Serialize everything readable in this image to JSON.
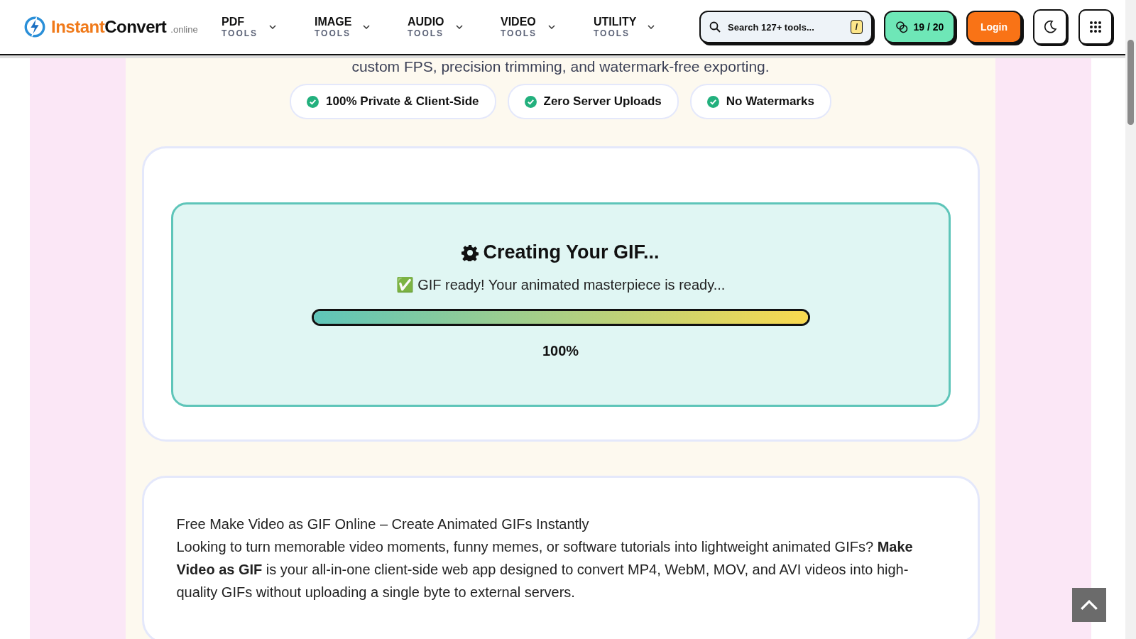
{
  "header": {
    "logo": {
      "brand": "Instant",
      "brand_rest": "Convert",
      "suffix": ".online"
    },
    "nav": [
      {
        "label": "PDF",
        "sub": "TOOLS"
      },
      {
        "label": "IMAGE",
        "sub": "TOOLS"
      },
      {
        "label": "AUDIO",
        "sub": "TOOLS"
      },
      {
        "label": "VIDEO",
        "sub": "TOOLS"
      },
      {
        "label": "UTILITY",
        "sub": "TOOLS"
      }
    ],
    "search": {
      "placeholder": "Search 127+ tools...",
      "shortcut": "/"
    },
    "usage": "19 / 20",
    "login": "Login"
  },
  "intro": "custom FPS, precision trimming, and watermark-free exporting.",
  "badges": [
    "100% Private & Client-Side",
    "Zero Server Uploads",
    "No Watermarks"
  ],
  "progress": {
    "title": "Creating Your GIF...",
    "status": "✅ GIF ready! Your animated masterpiece is ready...",
    "level": 1,
    "reading": "100%"
  },
  "article": {
    "heading": "Free Make Video as GIF Online – Create Animated GIFs Instantly",
    "paragraph": "Looking to turn memorable video moments, funny memes, or software tutorials into lightweight animated GIFs? **Make Video as GIF** is your all-in-one client-side web app designed to convert MP4, WebM, MOV, and AVI videos into high-quality GIFs without uploading a single byte to external servers."
  }
}
